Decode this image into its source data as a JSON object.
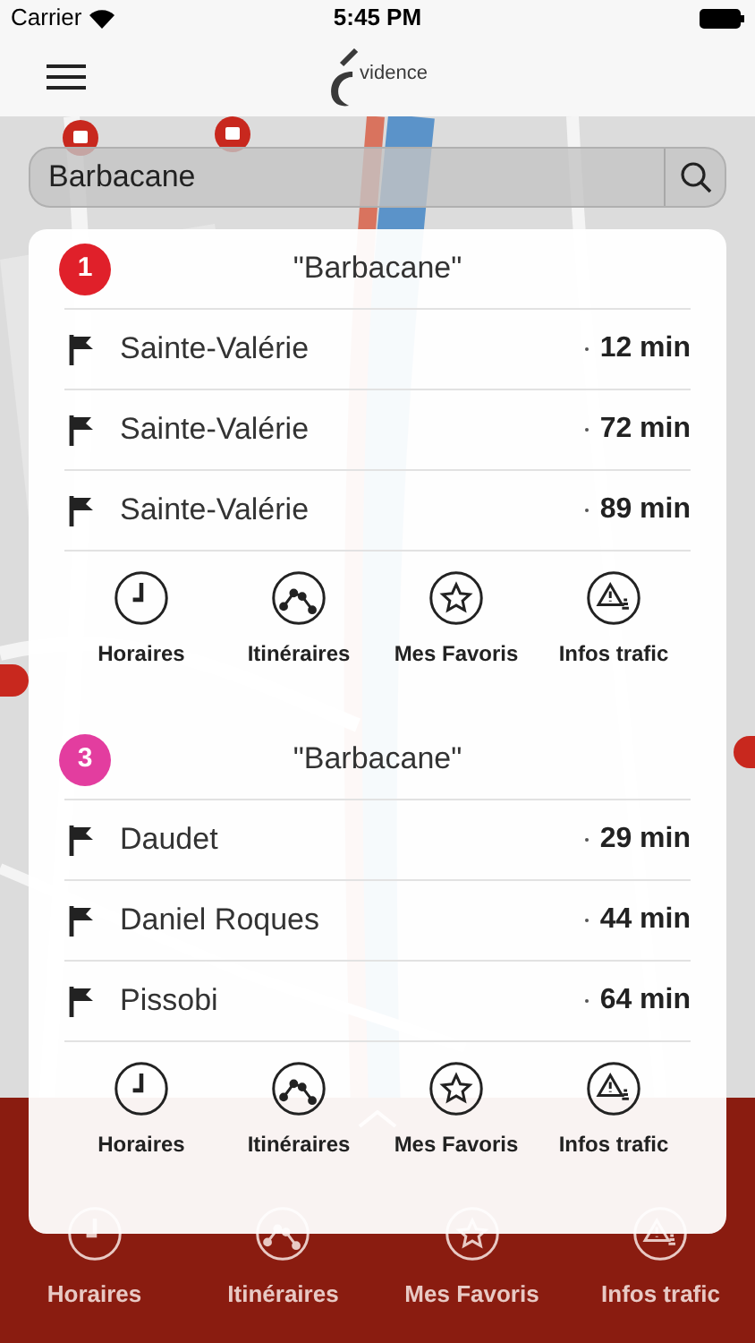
{
  "status_bar": {
    "carrier": "Carrier",
    "time": "5:45 PM"
  },
  "header": {
    "logo_text": "vidence"
  },
  "search": {
    "value": "Barbacane"
  },
  "groups": [
    {
      "number": "1",
      "color": "#e0202a",
      "title": "\"Barbacane\"",
      "departures": [
        {
          "destination": "Sainte-Valérie",
          "time": "12 min"
        },
        {
          "destination": "Sainte-Valérie",
          "time": "72 min"
        },
        {
          "destination": "Sainte-Valérie",
          "time": "89 min"
        }
      ],
      "actions": [
        {
          "kind": "clock",
          "label": "Horaires"
        },
        {
          "kind": "route",
          "label": "Itinéraires"
        },
        {
          "kind": "star",
          "label": "Mes Favoris"
        },
        {
          "kind": "warning",
          "label": "Infos trafic"
        }
      ]
    },
    {
      "number": "3",
      "color": "#e33d9f",
      "title": "\"Barbacane\"",
      "departures": [
        {
          "destination": "Daudet",
          "time": "29 min"
        },
        {
          "destination": "Daniel Roques",
          "time": "44 min"
        },
        {
          "destination": "Pissobi",
          "time": "64 min"
        }
      ],
      "actions": [
        {
          "kind": "clock",
          "label": "Horaires"
        },
        {
          "kind": "route",
          "label": "Itinéraires"
        },
        {
          "kind": "star",
          "label": "Mes Favoris"
        },
        {
          "kind": "warning",
          "label": "Infos trafic"
        }
      ]
    }
  ],
  "bottom_tabs": [
    {
      "kind": "clock",
      "label": "Horaires"
    },
    {
      "kind": "route",
      "label": "Itinéraires"
    },
    {
      "kind": "star",
      "label": "Mes Favoris"
    },
    {
      "kind": "warning",
      "label": "Infos trafic"
    }
  ]
}
